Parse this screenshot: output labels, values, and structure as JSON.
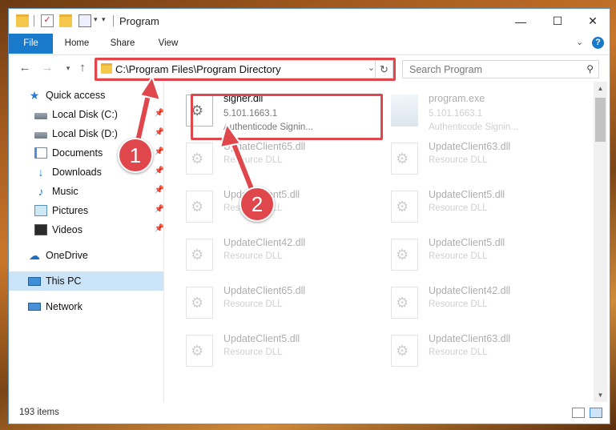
{
  "window": {
    "title": "Program",
    "controls": {
      "minimize": "—",
      "maximize": "☐",
      "close": "✕"
    }
  },
  "ribbon": {
    "tabs": [
      {
        "label": "File"
      },
      {
        "label": "Home"
      },
      {
        "label": "Share"
      },
      {
        "label": "View"
      }
    ]
  },
  "address": {
    "path": "C:\\Program Files\\Program Directory",
    "search_placeholder": "Search Program"
  },
  "sidebar": {
    "items": [
      {
        "label": "Quick access",
        "icon": "star-icon"
      },
      {
        "label": "Local Disk (C:)",
        "icon": "drive-icon",
        "pinned": true
      },
      {
        "label": "Local Disk (D:)",
        "icon": "drive-icon",
        "pinned": true
      },
      {
        "label": "Documents",
        "icon": "documents-icon",
        "pinned": true
      },
      {
        "label": "Downloads",
        "icon": "download-icon",
        "pinned": true
      },
      {
        "label": "Music",
        "icon": "music-icon",
        "pinned": true
      },
      {
        "label": "Pictures",
        "icon": "pictures-icon",
        "pinned": true
      },
      {
        "label": "Videos",
        "icon": "videos-icon",
        "pinned": true
      },
      {
        "label": "OneDrive",
        "icon": "cloud-icon"
      },
      {
        "label": "This PC",
        "icon": "computer-icon",
        "selected": true
      },
      {
        "label": "Network",
        "icon": "network-icon"
      }
    ]
  },
  "files": [
    {
      "name": "signer.dll",
      "line2": "5.101.1663.1",
      "line3": "Authenticode Signin...",
      "icon": "dll-gear-icon",
      "highlight": true
    },
    {
      "name": "program.exe",
      "line2": "5.101.1663.1",
      "line3": "Authenticode Signin...",
      "icon": "exe-icon",
      "faded": true
    },
    {
      "name": "UpdateClient65.dll",
      "line2": "Resource DLL",
      "faded": true
    },
    {
      "name": "UpdateClient63.dll",
      "line2": "Resource DLL",
      "faded": true
    },
    {
      "name": "UpdateClient5.dll",
      "line2": "Resource DLL",
      "faded": true
    },
    {
      "name": "UpdateClient5.dll",
      "line2": "Resource DLL",
      "faded": true
    },
    {
      "name": "UpdateClient42.dll",
      "line2": "Resource DLL",
      "faded": true
    },
    {
      "name": "UpdateClient5.dll",
      "line2": "Resource DLL",
      "faded": true
    },
    {
      "name": "UpdateClient65.dll",
      "line2": "Resource DLL",
      "faded": true
    },
    {
      "name": "UpdateClient42.dll",
      "line2": "Resource DLL",
      "faded": true
    },
    {
      "name": "UpdateClient5.dll",
      "line2": "Resource DLL",
      "faded": true
    },
    {
      "name": "UpdateClient63.dll",
      "line2": "Resource DLL",
      "faded": true
    }
  ],
  "status": {
    "item_count": "193 items"
  },
  "callouts": {
    "step1": "1",
    "step2": "2"
  },
  "colors": {
    "accent": "#1979ca",
    "highlight": "#e0474c",
    "selected": "#cce4f7"
  }
}
